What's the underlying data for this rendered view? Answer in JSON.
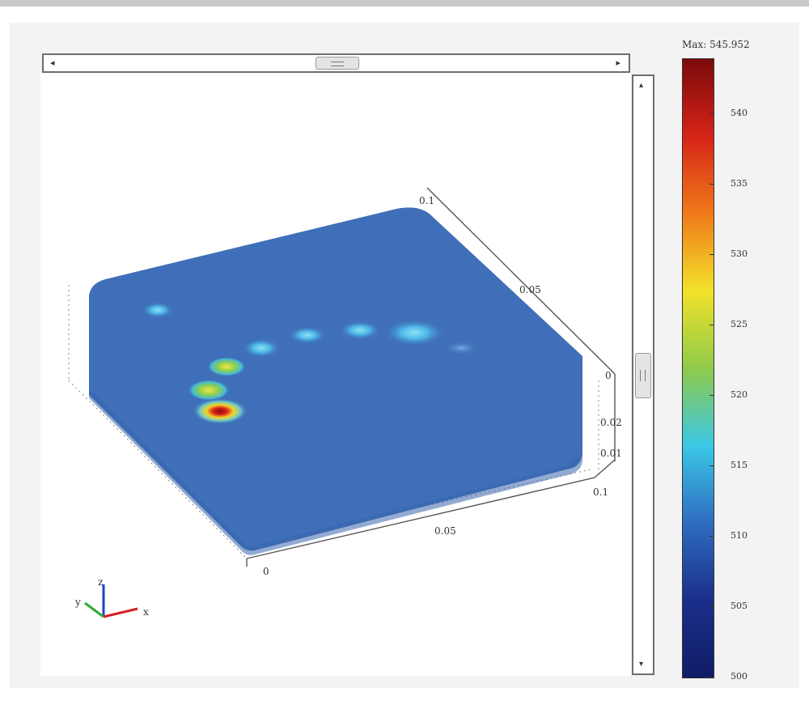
{
  "plot": {
    "axes_ticks": {
      "x_zero": "0",
      "x_mid": "0.05",
      "x_max": "0.1",
      "y_mid": "0.05",
      "y_max": "0.1",
      "z_zero": "0",
      "z_a": "0.02",
      "z_b": "0.01"
    },
    "triad": {
      "z": "z",
      "y": "y",
      "x": "x"
    }
  },
  "colorbar": {
    "title": "Max: 545.952",
    "ticks": [
      "540",
      "535",
      "530",
      "525",
      "520",
      "515",
      "510",
      "505",
      "500"
    ],
    "colors": [
      "#7a0a0a",
      "#d62418",
      "#f07a1a",
      "#f2e22a",
      "#8fca4a",
      "#3cc8e6",
      "#2e6cc0",
      "#1b2f8a",
      "#101d66"
    ]
  },
  "colors": {
    "surface": "#3f6fb8",
    "hot_spot": "#d81f1a"
  }
}
